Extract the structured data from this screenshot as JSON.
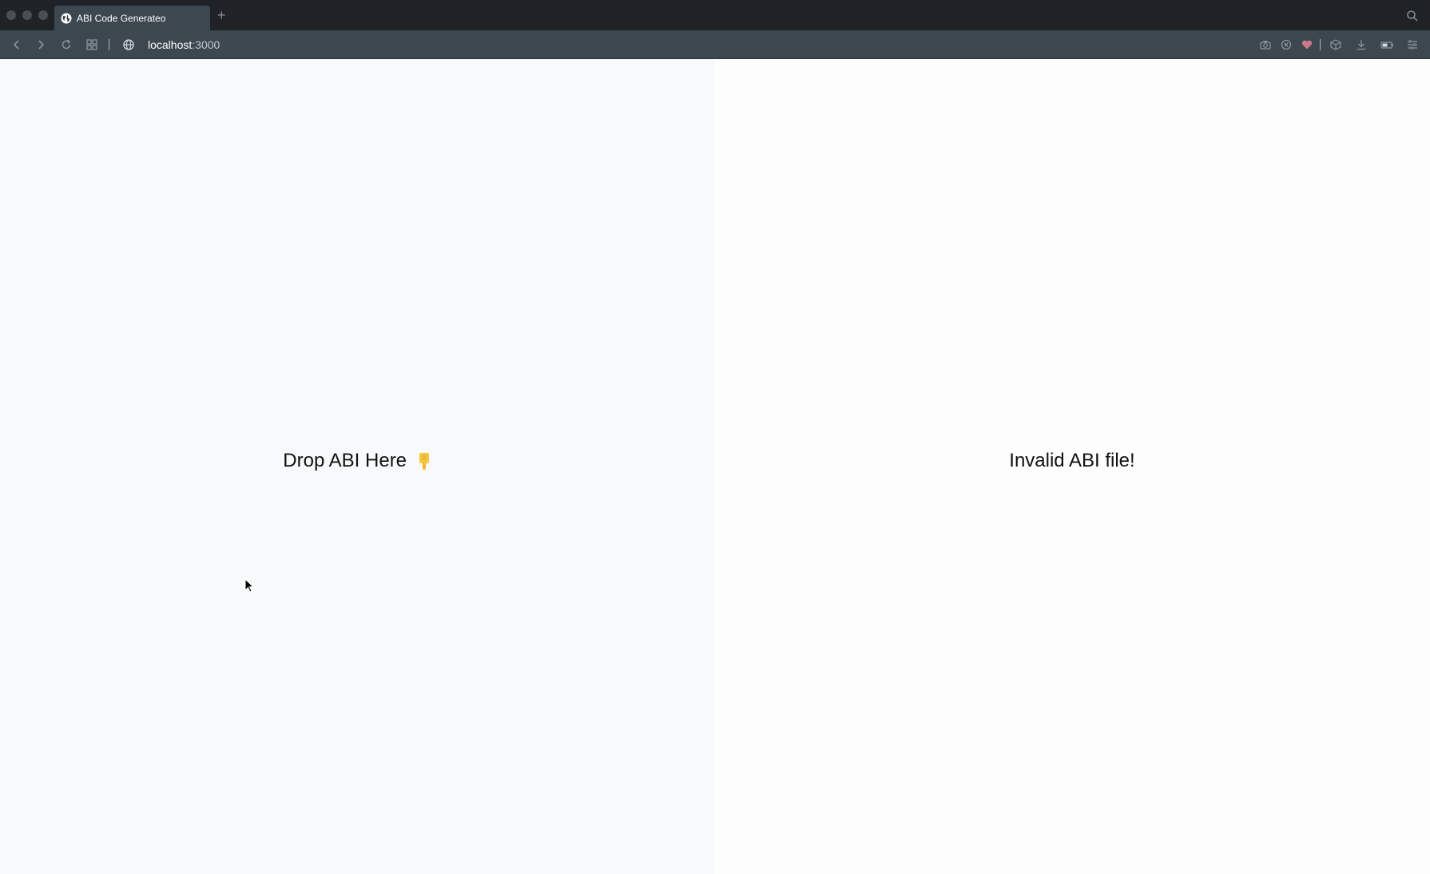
{
  "browser": {
    "tab": {
      "title": "ABI Code Generateo",
      "favicon": "globe-icon"
    },
    "new_tab_label": "+",
    "address": {
      "host": "localhost",
      "port": ":3000"
    },
    "icons": {
      "left": [
        "back-arrow-icon",
        "forward-arrow-icon",
        "reload-icon",
        "grid-icon",
        "globe-icon"
      ],
      "right": [
        "camera-icon",
        "close-circle-icon",
        "heart-icon",
        "box-icon",
        "download-icon",
        "battery-icon",
        "menu-icon"
      ]
    },
    "colors": {
      "tabbar": "#1f2328",
      "toolbar": "#3d4750",
      "heart": "#c97a88"
    }
  },
  "page": {
    "drop_zone": {
      "label": "Drop ABI Here",
      "icon": "pointing-down-hand-icon"
    },
    "status": {
      "message": "Invalid ABI file!"
    },
    "colors": {
      "left_background": "#f8f9fa",
      "right_background": "#fdfdfd",
      "text": "#111111"
    }
  }
}
